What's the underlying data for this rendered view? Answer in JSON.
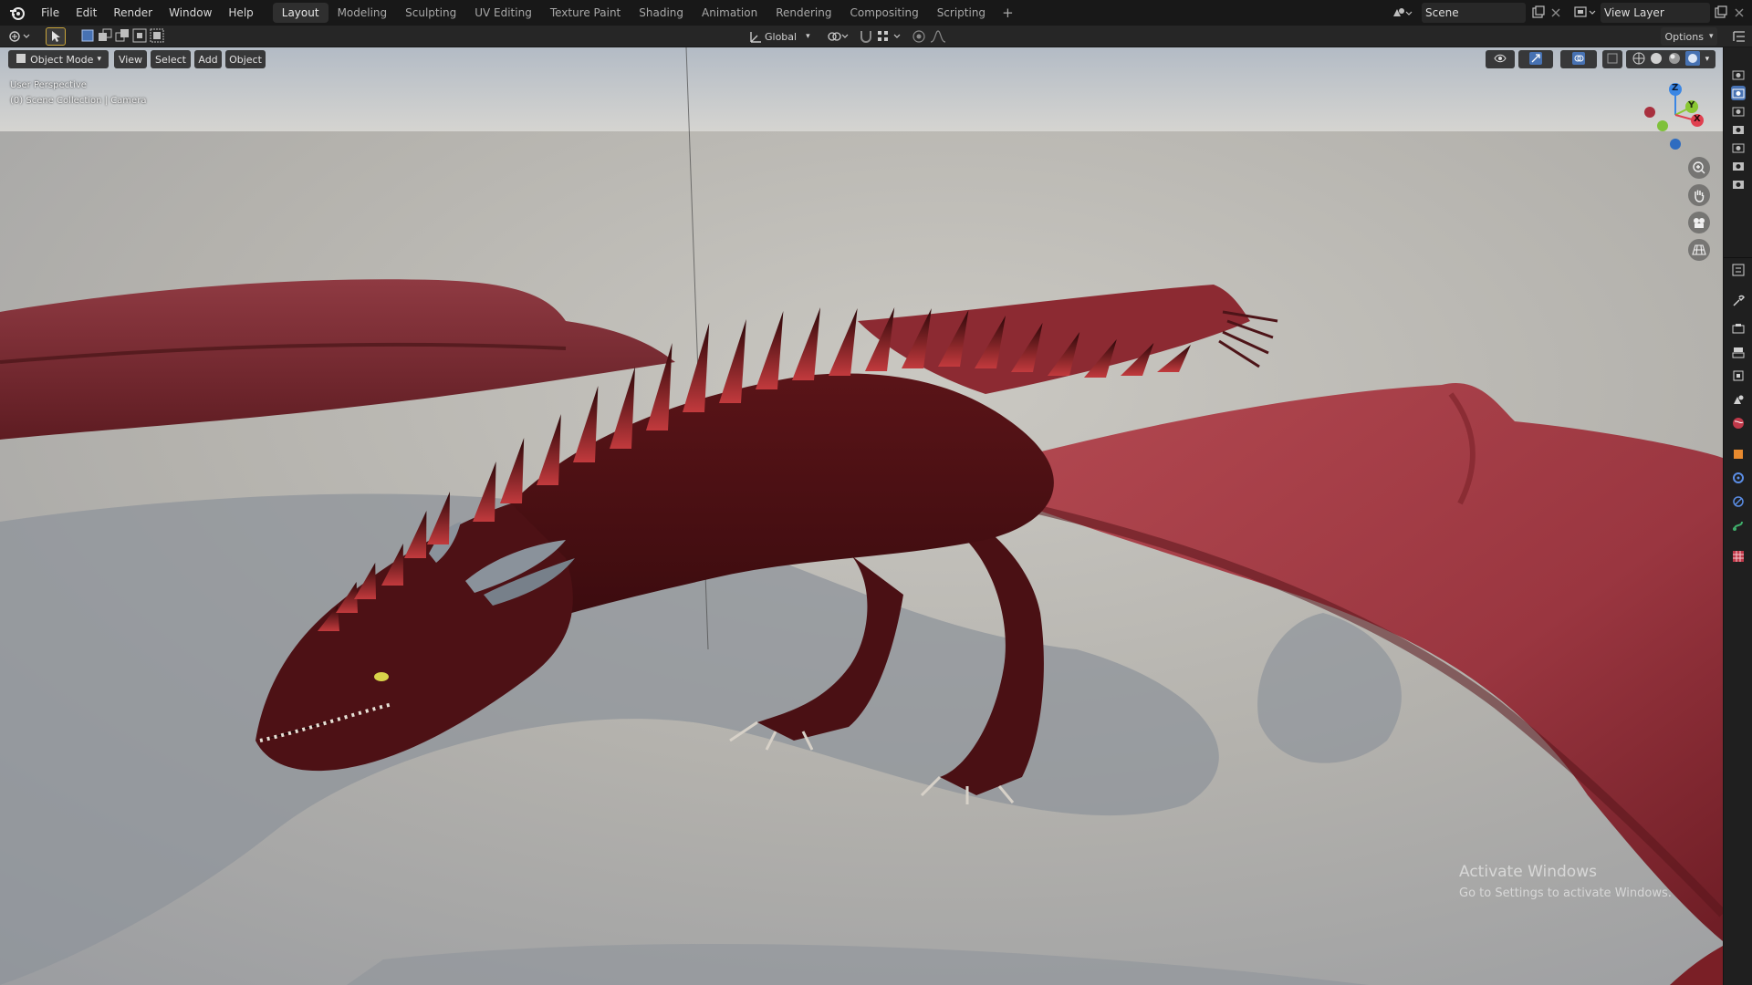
{
  "menu": [
    "File",
    "Edit",
    "Render",
    "Window",
    "Help"
  ],
  "workspaces": [
    "Layout",
    "Modeling",
    "Sculpting",
    "UV Editing",
    "Texture Paint",
    "Shading",
    "Animation",
    "Rendering",
    "Compositing",
    "Scripting"
  ],
  "active_workspace": "Layout",
  "add_workspace": "+",
  "scene": {
    "label": "Scene"
  },
  "view_layer": {
    "label": "View Layer"
  },
  "header": {
    "mode": "Object Mode",
    "view": "View",
    "select": "Select",
    "add": "Add",
    "object": "Object",
    "orientation": "Global",
    "options": "Options"
  },
  "viewport": {
    "perspective": "User Perspective",
    "collection": "(0) Scene Collection | Camera"
  },
  "gizmo": {
    "z": "Z",
    "y": "Y",
    "x": "X"
  },
  "watermark": {
    "title": "Activate Windows",
    "subtitle": "Go to Settings to activate Windows."
  },
  "colors": {
    "accent": "#4772b3",
    "dragon": "#8b1d24",
    "axis_x": "#e0404f",
    "axis_y": "#8ac832",
    "axis_z": "#3a86e4"
  }
}
